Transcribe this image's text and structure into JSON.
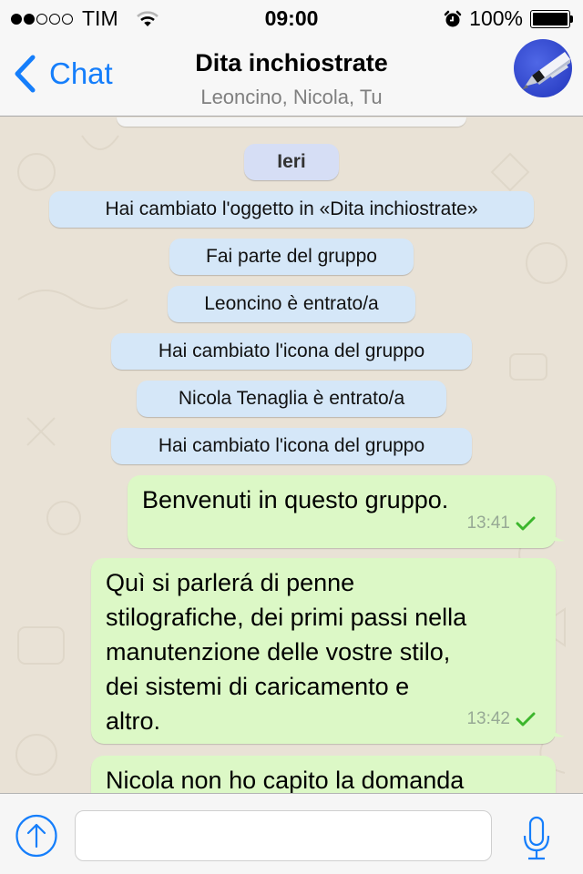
{
  "status_bar": {
    "signal_strength": 2,
    "signal_max": 5,
    "carrier": "TIM",
    "time": "09:00",
    "battery_percent": "100%",
    "battery_level": 1.0,
    "icons": [
      "wifi-icon",
      "alarm-clock-icon",
      "battery-icon"
    ]
  },
  "nav": {
    "back_label": "Chat",
    "title": "Dita inchiostrate",
    "subtitle": "Leoncino, Nicola, Tu",
    "avatar_icon": "fountain-pen-photo"
  },
  "chat": {
    "date_separator": "Ieri",
    "system_messages": [
      "Hai cambiato l'oggetto in «Dita inchiostrate»",
      "Fai parte del gruppo",
      "Leoncino è entrato/a",
      "Hai cambiato l'icona del gruppo",
      "Nicola Tenaglia è entrato/a",
      "Hai cambiato l'icona del gruppo"
    ],
    "messages": [
      {
        "text": "Benvenuti in questo gruppo.",
        "time": "13:41",
        "status": "sent-check",
        "outgoing": true
      },
      {
        "lines": [
          "Quì si parlerá di penne",
          "stilografiche, dei primi passi nella",
          "manutenzione delle vostre stilo,",
          "dei sistemi di caricamento e",
          "altro."
        ],
        "time": "13:42",
        "status": "sent-check",
        "outgoing": true
      },
      {
        "text": "Nicola non ho capito la domanda",
        "outgoing": true
      }
    ]
  },
  "input_bar": {
    "message_value": "",
    "message_placeholder": "",
    "attach_icon": "upload-arrow-icon",
    "mic_icon": "microphone-icon"
  },
  "colors": {
    "accent": "#157efb",
    "outgoing_bubble": "#dcf8c6",
    "system_bubble": "#d5e7f8",
    "date_bubble": "#d6def5",
    "check": "#3cb62c"
  }
}
